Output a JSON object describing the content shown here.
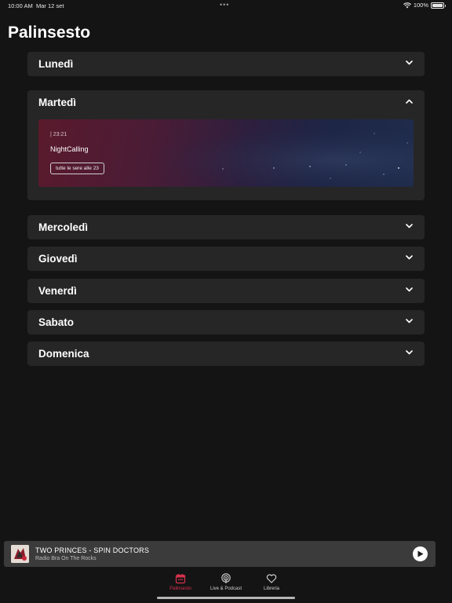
{
  "status_bar": {
    "time": "10:00 AM",
    "date": "Mar 12 set",
    "dots": "•••",
    "battery": "100%"
  },
  "page": {
    "title": "Palinsesto"
  },
  "days": [
    {
      "label": "Lunedì",
      "expanded": false
    },
    {
      "label": "Martedì",
      "expanded": true
    },
    {
      "label": "Mercoledì",
      "expanded": false
    },
    {
      "label": "Giovedì",
      "expanded": false
    },
    {
      "label": "Venerdì",
      "expanded": false
    },
    {
      "label": "Sabato",
      "expanded": false
    },
    {
      "label": "Domenica",
      "expanded": false
    }
  ],
  "show": {
    "time": "| 23:21",
    "name": "NightCalling",
    "schedule_button": "tutte le sere alle 23"
  },
  "player": {
    "title": "TWO PRINCES - SPIN DOCTORS",
    "station": "Radio Bra On The Rocks"
  },
  "tabs": [
    {
      "label": "Palinsesto",
      "icon": "calendar-icon",
      "active": true
    },
    {
      "label": "Live & Podcast",
      "icon": "podcast-icon",
      "active": false
    },
    {
      "label": "Libreria",
      "icon": "heart-icon",
      "active": false
    }
  ],
  "colors": {
    "background": "#141414",
    "card": "#262626",
    "accent": "#d6304d",
    "player": "#3b3b3b"
  }
}
